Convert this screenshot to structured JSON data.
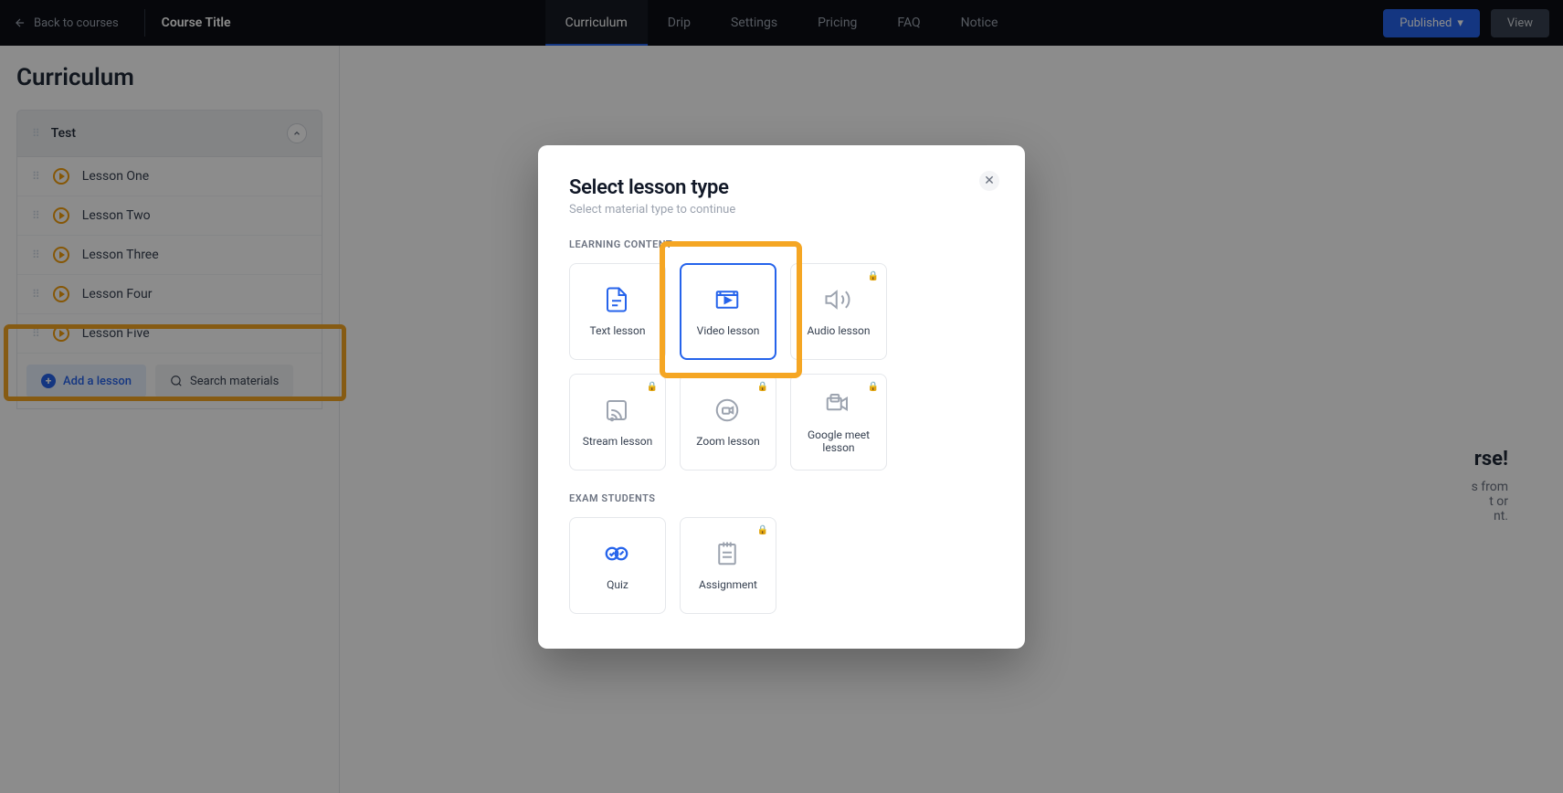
{
  "header": {
    "back_label": "Back to courses",
    "course_title": "Course Title",
    "nav": [
      {
        "label": "Curriculum",
        "active": true
      },
      {
        "label": "Drip",
        "active": false
      },
      {
        "label": "Settings",
        "active": false
      },
      {
        "label": "Pricing",
        "active": false
      },
      {
        "label": "FAQ",
        "active": false
      },
      {
        "label": "Notice",
        "active": false
      }
    ],
    "published_label": "Published",
    "view_label": "View"
  },
  "sidebar": {
    "page_title": "Curriculum",
    "section_name": "Test",
    "lessons": [
      {
        "label": "Lesson One"
      },
      {
        "label": "Lesson Two"
      },
      {
        "label": "Lesson Three"
      },
      {
        "label": "Lesson Four"
      },
      {
        "label": "Lesson Five"
      }
    ],
    "add_label": "Add a lesson",
    "search_label": "Search materials"
  },
  "content": {
    "heading_suffix": "rse!",
    "line1": "s from",
    "line2": "t or",
    "line3": "nt."
  },
  "modal": {
    "title": "Select lesson type",
    "subtitle": "Select material type to continue",
    "section_learning": "LEARNING CONTENT",
    "section_exam": "EXAM STUDENTS",
    "learning_types": [
      {
        "label": "Text lesson",
        "locked": false,
        "selected": false,
        "icon": "doc"
      },
      {
        "label": "Video lesson",
        "locked": false,
        "selected": true,
        "icon": "video"
      },
      {
        "label": "Audio lesson",
        "locked": true,
        "selected": false,
        "icon": "audio"
      },
      {
        "label": "Stream lesson",
        "locked": true,
        "selected": false,
        "icon": "stream"
      },
      {
        "label": "Zoom lesson",
        "locked": true,
        "selected": false,
        "icon": "zoom"
      },
      {
        "label": "Google meet lesson",
        "locked": true,
        "selected": false,
        "icon": "meet"
      }
    ],
    "exam_types": [
      {
        "label": "Quiz",
        "locked": false,
        "selected": false,
        "icon": "quiz"
      },
      {
        "label": "Assignment",
        "locked": true,
        "selected": false,
        "icon": "assignment"
      }
    ]
  }
}
